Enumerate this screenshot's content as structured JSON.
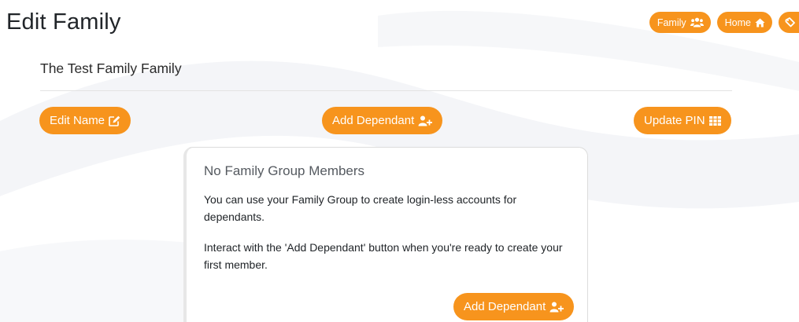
{
  "page": {
    "title": "Edit Family",
    "family_name": "The Test Family Family"
  },
  "top_nav": {
    "family_label": "Family",
    "home_label": "Home",
    "family_icon": "users-icon",
    "home_icon": "home-icon",
    "cut_icon": "tag-icon"
  },
  "actions": {
    "edit_name_label": "Edit Name",
    "add_dependant_label": "Add Dependant",
    "update_pin_label": "Update PIN"
  },
  "empty_state": {
    "title": "No Family Group Members",
    "paragraph_1": "You can use your Family Group to create login-less accounts for dependants.",
    "paragraph_2": "Interact with the 'Add Dependant' button when you're ready to create your first member.",
    "button_label": "Add Dependant"
  },
  "colors": {
    "accent": "#f7941d",
    "button_text": "#ffffff",
    "background": "#ffffff"
  }
}
